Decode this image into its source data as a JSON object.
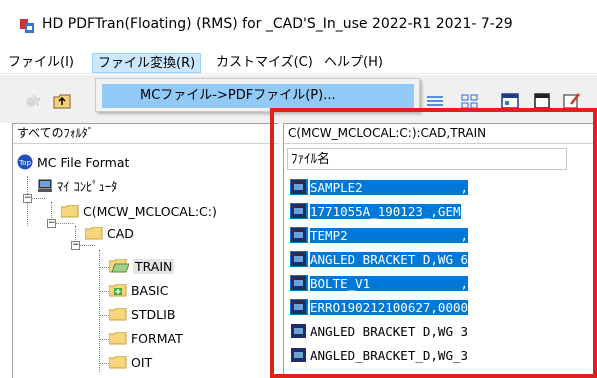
{
  "window": {
    "title": "HD PDFTran(Floating) (RMS) for _CAD'S_In_use 2022-R1 2021- 7-29"
  },
  "menubar": {
    "items": [
      {
        "label": "ファイル(I)"
      },
      {
        "label": "ファイル変換(R)"
      },
      {
        "label": "カストマイズ(C)"
      },
      {
        "label": "ヘルプ(H)"
      }
    ]
  },
  "dropdown": {
    "items": [
      {
        "label": "MCファイル->PDFファイル(P)..."
      }
    ]
  },
  "left_pane": {
    "header": "すべてのﾌｫﾙﾀﾞ",
    "tree": [
      {
        "label": "MC File Format"
      },
      {
        "label": "ﾏｲ ｺﾝﾋﾟｭｰﾀ"
      },
      {
        "label": "C(MCW_MCLOCAL:C:)"
      },
      {
        "label": "CAD"
      },
      {
        "label": "TRAIN"
      },
      {
        "label": "BASIC"
      },
      {
        "label": "STDLIB"
      },
      {
        "label": "FORMAT"
      },
      {
        "label": "OIT"
      }
    ]
  },
  "right_pane": {
    "path": "C(MCW_MCLOCAL:C:):CAD,TRAIN",
    "column_header": "ﾌｧｲﾙ名",
    "files": [
      {
        "name": "SAMPLE2             ,",
        "selected": true
      },
      {
        "name": "1771055A_190123_,GEM",
        "selected": true
      },
      {
        "name": "TEMP2               ,",
        "selected": true
      },
      {
        "name": "ANGLED BRACKET D,WG 6",
        "selected": true
      },
      {
        "name": "BOLTE_V1            ,",
        "selected": true
      },
      {
        "name": "ERRO190212100627,0000",
        "selected": true
      },
      {
        "name": "ANGLED BRACKET D,WG 3",
        "selected": false
      },
      {
        "name": "ANGLED_BRACKET_D,WG_3",
        "selected": false
      }
    ]
  },
  "colors": {
    "selection": "#0078d7",
    "menu_active": "#cce8ff",
    "dropdown_highlight": "#91c9f7",
    "annotation_frame": "#e0201a"
  }
}
